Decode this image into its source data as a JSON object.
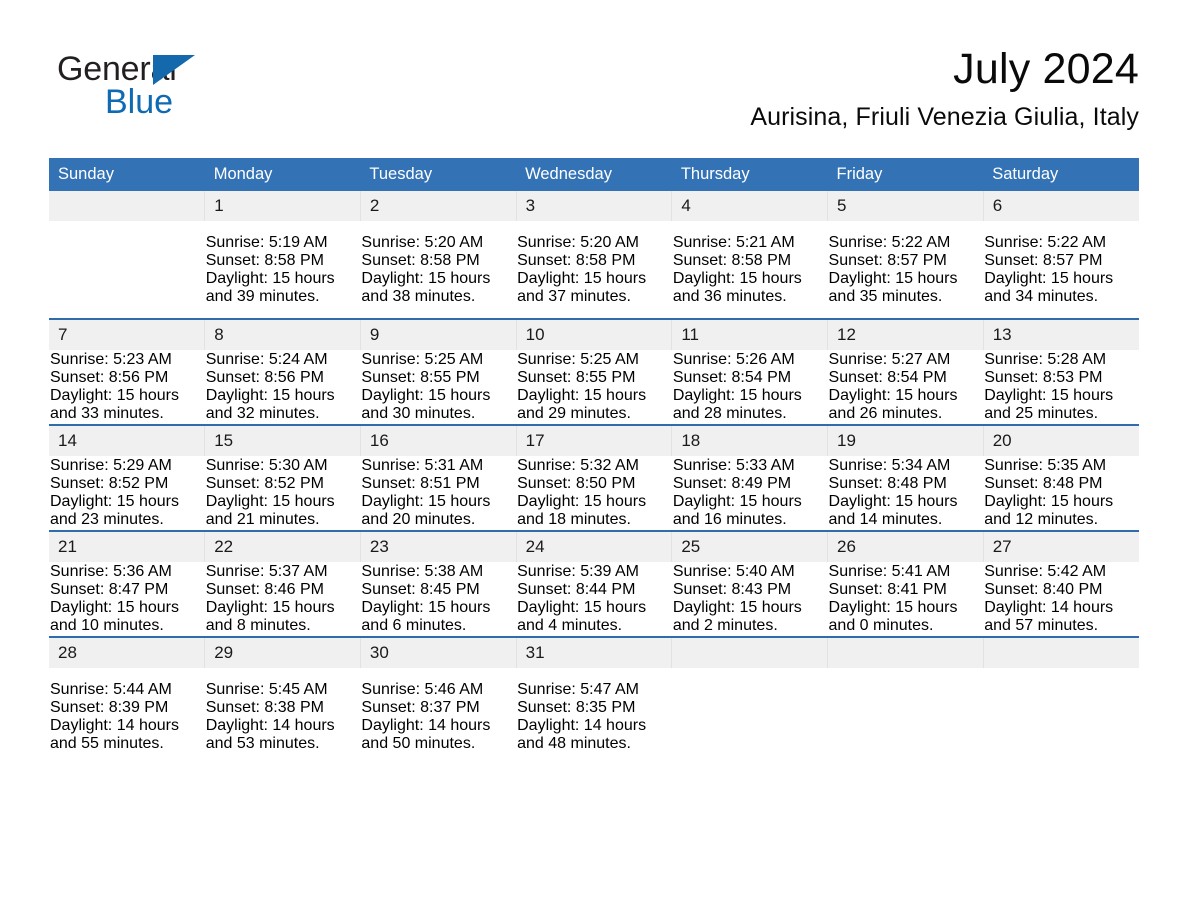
{
  "brand": {
    "name_part1": "General",
    "name_part2": "Blue",
    "triangle_color": "#1469ac",
    "accent_color": "#0f6ab4"
  },
  "header": {
    "month_title": "July 2024",
    "location": "Aurisina, Friuli Venezia Giulia, Italy"
  },
  "calendar": {
    "header_bg": "#3372b5",
    "daynum_bg": "#f0f0f0",
    "row_rule_color": "#2e6da9",
    "weekday_labels": [
      "Sunday",
      "Monday",
      "Tuesday",
      "Wednesday",
      "Thursday",
      "Friday",
      "Saturday"
    ],
    "weeks": [
      [
        {
          "day": "",
          "lines": []
        },
        {
          "day": "1",
          "lines": [
            "Sunrise: 5:19 AM",
            "Sunset: 8:58 PM",
            "Daylight: 15 hours",
            "and 39 minutes."
          ]
        },
        {
          "day": "2",
          "lines": [
            "Sunrise: 5:20 AM",
            "Sunset: 8:58 PM",
            "Daylight: 15 hours",
            "and 38 minutes."
          ]
        },
        {
          "day": "3",
          "lines": [
            "Sunrise: 5:20 AM",
            "Sunset: 8:58 PM",
            "Daylight: 15 hours",
            "and 37 minutes."
          ]
        },
        {
          "day": "4",
          "lines": [
            "Sunrise: 5:21 AM",
            "Sunset: 8:58 PM",
            "Daylight: 15 hours",
            "and 36 minutes."
          ]
        },
        {
          "day": "5",
          "lines": [
            "Sunrise: 5:22 AM",
            "Sunset: 8:57 PM",
            "Daylight: 15 hours",
            "and 35 minutes."
          ]
        },
        {
          "day": "6",
          "lines": [
            "Sunrise: 5:22 AM",
            "Sunset: 8:57 PM",
            "Daylight: 15 hours",
            "and 34 minutes."
          ]
        }
      ],
      [
        {
          "day": "7",
          "lines": [
            "Sunrise: 5:23 AM",
            "Sunset: 8:56 PM",
            "Daylight: 15 hours",
            "and 33 minutes."
          ]
        },
        {
          "day": "8",
          "lines": [
            "Sunrise: 5:24 AM",
            "Sunset: 8:56 PM",
            "Daylight: 15 hours",
            "and 32 minutes."
          ]
        },
        {
          "day": "9",
          "lines": [
            "Sunrise: 5:25 AM",
            "Sunset: 8:55 PM",
            "Daylight: 15 hours",
            "and 30 minutes."
          ]
        },
        {
          "day": "10",
          "lines": [
            "Sunrise: 5:25 AM",
            "Sunset: 8:55 PM",
            "Daylight: 15 hours",
            "and 29 minutes."
          ]
        },
        {
          "day": "11",
          "lines": [
            "Sunrise: 5:26 AM",
            "Sunset: 8:54 PM",
            "Daylight: 15 hours",
            "and 28 minutes."
          ]
        },
        {
          "day": "12",
          "lines": [
            "Sunrise: 5:27 AM",
            "Sunset: 8:54 PM",
            "Daylight: 15 hours",
            "and 26 minutes."
          ]
        },
        {
          "day": "13",
          "lines": [
            "Sunrise: 5:28 AM",
            "Sunset: 8:53 PM",
            "Daylight: 15 hours",
            "and 25 minutes."
          ]
        }
      ],
      [
        {
          "day": "14",
          "lines": [
            "Sunrise: 5:29 AM",
            "Sunset: 8:52 PM",
            "Daylight: 15 hours",
            "and 23 minutes."
          ]
        },
        {
          "day": "15",
          "lines": [
            "Sunrise: 5:30 AM",
            "Sunset: 8:52 PM",
            "Daylight: 15 hours",
            "and 21 minutes."
          ]
        },
        {
          "day": "16",
          "lines": [
            "Sunrise: 5:31 AM",
            "Sunset: 8:51 PM",
            "Daylight: 15 hours",
            "and 20 minutes."
          ]
        },
        {
          "day": "17",
          "lines": [
            "Sunrise: 5:32 AM",
            "Sunset: 8:50 PM",
            "Daylight: 15 hours",
            "and 18 minutes."
          ]
        },
        {
          "day": "18",
          "lines": [
            "Sunrise: 5:33 AM",
            "Sunset: 8:49 PM",
            "Daylight: 15 hours",
            "and 16 minutes."
          ]
        },
        {
          "day": "19",
          "lines": [
            "Sunrise: 5:34 AM",
            "Sunset: 8:48 PM",
            "Daylight: 15 hours",
            "and 14 minutes."
          ]
        },
        {
          "day": "20",
          "lines": [
            "Sunrise: 5:35 AM",
            "Sunset: 8:48 PM",
            "Daylight: 15 hours",
            "and 12 minutes."
          ]
        }
      ],
      [
        {
          "day": "21",
          "lines": [
            "Sunrise: 5:36 AM",
            "Sunset: 8:47 PM",
            "Daylight: 15 hours",
            "and 10 minutes."
          ]
        },
        {
          "day": "22",
          "lines": [
            "Sunrise: 5:37 AM",
            "Sunset: 8:46 PM",
            "Daylight: 15 hours",
            "and 8 minutes."
          ]
        },
        {
          "day": "23",
          "lines": [
            "Sunrise: 5:38 AM",
            "Sunset: 8:45 PM",
            "Daylight: 15 hours",
            "and 6 minutes."
          ]
        },
        {
          "day": "24",
          "lines": [
            "Sunrise: 5:39 AM",
            "Sunset: 8:44 PM",
            "Daylight: 15 hours",
            "and 4 minutes."
          ]
        },
        {
          "day": "25",
          "lines": [
            "Sunrise: 5:40 AM",
            "Sunset: 8:43 PM",
            "Daylight: 15 hours",
            "and 2 minutes."
          ]
        },
        {
          "day": "26",
          "lines": [
            "Sunrise: 5:41 AM",
            "Sunset: 8:41 PM",
            "Daylight: 15 hours",
            "and 0 minutes."
          ]
        },
        {
          "day": "27",
          "lines": [
            "Sunrise: 5:42 AM",
            "Sunset: 8:40 PM",
            "Daylight: 14 hours",
            "and 57 minutes."
          ]
        }
      ],
      [
        {
          "day": "28",
          "lines": [
            "Sunrise: 5:44 AM",
            "Sunset: 8:39 PM",
            "Daylight: 14 hours",
            "and 55 minutes."
          ]
        },
        {
          "day": "29",
          "lines": [
            "Sunrise: 5:45 AM",
            "Sunset: 8:38 PM",
            "Daylight: 14 hours",
            "and 53 minutes."
          ]
        },
        {
          "day": "30",
          "lines": [
            "Sunrise: 5:46 AM",
            "Sunset: 8:37 PM",
            "Daylight: 14 hours",
            "and 50 minutes."
          ]
        },
        {
          "day": "31",
          "lines": [
            "Sunrise: 5:47 AM",
            "Sunset: 8:35 PM",
            "Daylight: 14 hours",
            "and 48 minutes."
          ]
        },
        {
          "day": "",
          "lines": []
        },
        {
          "day": "",
          "lines": []
        },
        {
          "day": "",
          "lines": []
        }
      ]
    ]
  }
}
